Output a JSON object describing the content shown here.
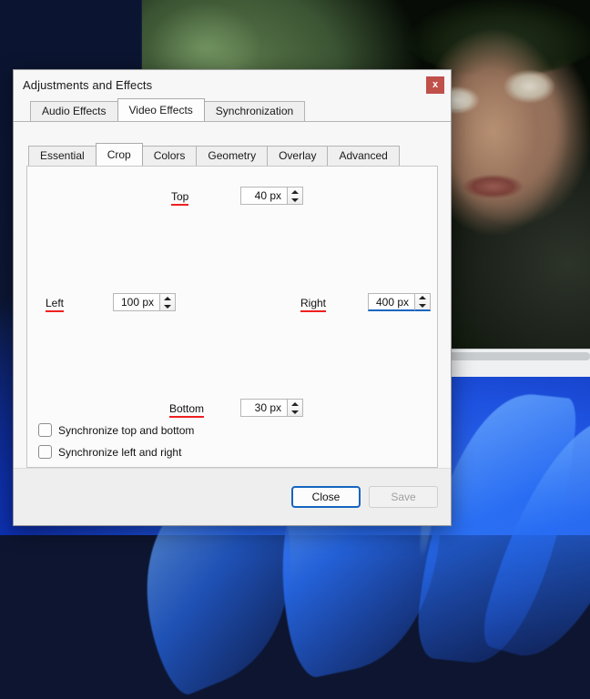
{
  "desktop": {
    "wallpaper_name": "windows-bloom-wallpaper",
    "background_color": "#0b1430",
    "accent_color": "#1e52e0"
  },
  "player": {
    "name": "video-player-window",
    "seek_percent": 45,
    "seek_fill_color": "#1e7fd4",
    "frame_description": "soldier-in-jungle-video-frame"
  },
  "dialog": {
    "title": "Adjustments and Effects",
    "close_icon": "close-x-icon",
    "close_label": "x",
    "close_color": "#c0504a"
  },
  "outer_tabs": {
    "active": "Video Effects",
    "items": [
      {
        "label": "Audio Effects",
        "active": false
      },
      {
        "label": "Video Effects",
        "active": true
      },
      {
        "label": "Synchronization",
        "active": false
      }
    ]
  },
  "inner_tabs": {
    "active": "Crop",
    "items": [
      {
        "label": "Essential",
        "active": false
      },
      {
        "label": "Crop",
        "active": true
      },
      {
        "label": "Colors",
        "active": false
      },
      {
        "label": "Geometry",
        "active": false
      },
      {
        "label": "Overlay",
        "active": false
      },
      {
        "label": "Advanced",
        "active": false
      }
    ]
  },
  "crop": {
    "underline_color": "#ef2020",
    "focus_color": "#1565c0",
    "fields": [
      {
        "key": "top",
        "label": "Top",
        "value": "40 px",
        "focused": false
      },
      {
        "key": "left",
        "label": "Left",
        "value": "100 px",
        "focused": false
      },
      {
        "key": "right",
        "label": "Right",
        "value": "400 px",
        "focused": true
      },
      {
        "key": "bottom",
        "label": "Bottom",
        "value": "30 px",
        "focused": false
      }
    ],
    "checkboxes": [
      {
        "key": "sync_top_bottom",
        "label": "Synchronize top and bottom",
        "checked": false
      },
      {
        "key": "sync_left_right",
        "label": "Synchronize left and right",
        "checked": false
      }
    ]
  },
  "footer": {
    "close_label": "Close",
    "save_label": "Save",
    "close_is_default": true,
    "save_is_disabled": true
  }
}
